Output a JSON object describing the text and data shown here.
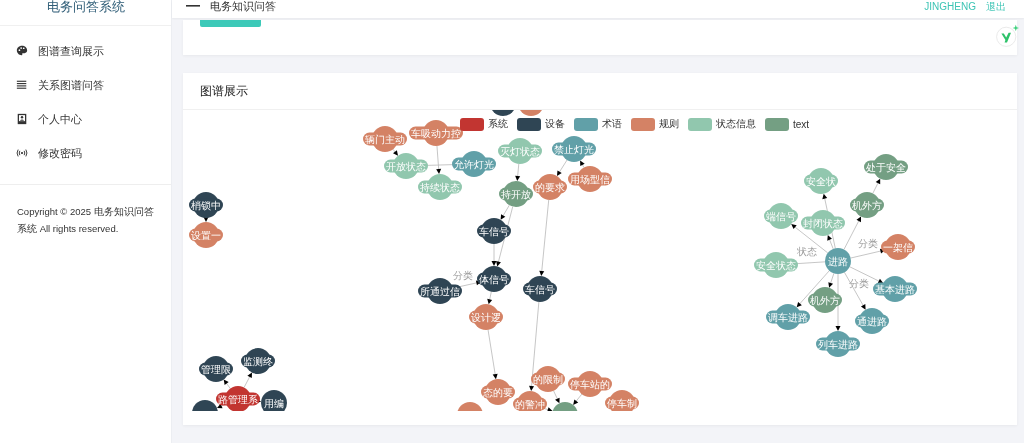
{
  "sidebar": {
    "title": "电务问答系统",
    "items": [
      {
        "label": "图谱查询展示",
        "selected": false
      },
      {
        "label": "关系图谱问答",
        "selected": false
      },
      {
        "label": "个人中心",
        "selected": false
      },
      {
        "label": "修改密码",
        "selected": false
      }
    ],
    "copyright": "Copyright © 2025 电务知识问答系统 All rights reserved."
  },
  "header": {
    "title": "电务知识问答",
    "user": "JINGHENG",
    "logout": "退出"
  },
  "graph_card": {
    "title": "图谱展示",
    "legend": [
      {
        "name": "系统",
        "color": "#c23531"
      },
      {
        "name": "设备",
        "color": "#2f4554"
      },
      {
        "name": "术语",
        "color": "#61a0a8"
      },
      {
        "name": "规则",
        "color": "#d48265"
      },
      {
        "name": "状态信息",
        "color": "#91c7ae"
      },
      {
        "name": "text",
        "color": "#749f83"
      }
    ],
    "nodes": [
      {
        "label": "辆门主动",
        "color": "#d48265"
      },
      {
        "label": "车吸动力控",
        "color": "#d48265"
      },
      {
        "color": "#2f4554"
      },
      {
        "color": "#d48265"
      },
      {
        "label": "禁止灯光",
        "color": "#61a0a8"
      },
      {
        "label": "灭灯状态",
        "color": "#91c7ae"
      },
      {
        "label": "开放状态",
        "color": "#91c7ae"
      },
      {
        "label": "持续状态",
        "color": "#91c7ae"
      },
      {
        "label": "允许灯光",
        "color": "#61a0a8"
      },
      {
        "label": "持开放",
        "color": "#749f83"
      },
      {
        "label": "的要求",
        "color": "#d48265"
      },
      {
        "label": "用场型信",
        "color": "#d48265"
      },
      {
        "label": "车信号",
        "color": "#2f4554"
      },
      {
        "label": "体信号",
        "color": "#2f4554"
      },
      {
        "label": "所通过信",
        "color": "#2f4554"
      },
      {
        "label": "设计逻",
        "color": "#d48265"
      },
      {
        "label": "车信号",
        "color": "#2f4554"
      },
      {
        "label": "梢锁中",
        "color": "#2f4554"
      },
      {
        "label": "设置一",
        "color": "#d48265"
      },
      {
        "label": "管理限",
        "color": "#2f4554"
      },
      {
        "label": "监测终",
        "color": "#2f4554"
      },
      {
        "label": "路管理系",
        "color": "#c23531"
      },
      {
        "label": "用编",
        "color": "#2f4554"
      },
      {
        "color": "#2f4554"
      },
      {
        "label": "态的要",
        "color": "#d48265"
      },
      {
        "label": "的警冲",
        "color": "#d48265"
      },
      {
        "label": "的限制",
        "color": "#d48265"
      },
      {
        "label": "停车站的",
        "color": "#d48265"
      },
      {
        "label": "停车制",
        "color": "#d48265"
      },
      {
        "color": "#d48265"
      },
      {
        "color": "#749f83"
      },
      {
        "label": "进路",
        "color": "#61a0a8"
      },
      {
        "label": "安全状",
        "color": "#91c7ae"
      },
      {
        "label": "处于安全",
        "color": "#749f83"
      },
      {
        "label": "机外方",
        "color": "#749f83"
      },
      {
        "label": "端信号",
        "color": "#91c7ae"
      },
      {
        "label": "封闭状态",
        "color": "#91c7ae"
      },
      {
        "label": "一架信",
        "color": "#d48265"
      },
      {
        "label": "安全状态",
        "color": "#91c7ae"
      },
      {
        "label": "基本进路",
        "color": "#61a0a8"
      },
      {
        "label": "机外方",
        "color": "#749f83"
      },
      {
        "label": "调车进路",
        "color": "#61a0a8"
      },
      {
        "label": "通进路",
        "color": "#61a0a8"
      },
      {
        "label": "列车进路",
        "color": "#61a0a8"
      }
    ],
    "edge_labels": [
      "分类",
      "状态",
      "分类",
      "分类"
    ]
  }
}
